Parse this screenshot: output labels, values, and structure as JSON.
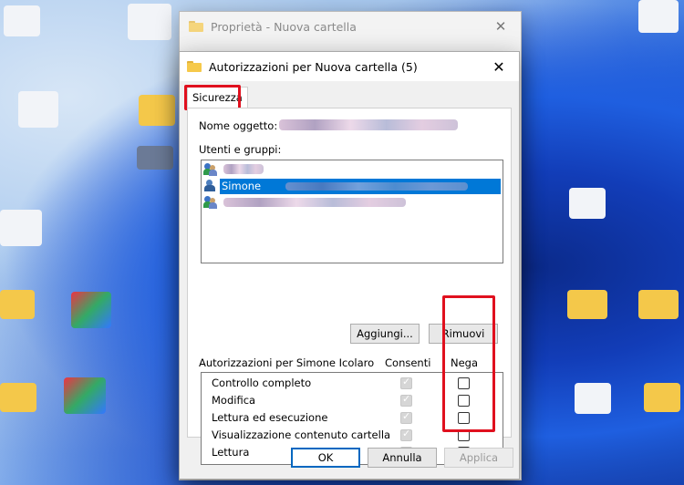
{
  "background_window": {
    "title": "Proprietà - Nuova cartella"
  },
  "dialog": {
    "title": "Autorizzazioni per Nuova cartella (5)",
    "tab_label": "Sicurezza",
    "object_name_label": "Nome oggetto:",
    "users_groups_label": "Utenti e gruppi:",
    "users": [
      {
        "name": "",
        "icon": "group-icon"
      },
      {
        "name": "Simone",
        "icon": "user-icon",
        "selected": true
      },
      {
        "name": "",
        "icon": "group-icon"
      }
    ],
    "add_button": "Aggiungi...",
    "remove_button": "Rimuovi",
    "permissions_for_label": "Autorizzazioni per Simone Icolaro",
    "allow_header": "Consenti",
    "deny_header": "Nega",
    "permissions": [
      {
        "name": "Controllo completo",
        "allow": true,
        "deny": false
      },
      {
        "name": "Modifica",
        "allow": true,
        "deny": false
      },
      {
        "name": "Lettura ed esecuzione",
        "allow": true,
        "deny": false
      },
      {
        "name": "Visualizzazione contenuto cartella",
        "allow": true,
        "deny": false
      },
      {
        "name": "Lettura",
        "allow": true,
        "deny": false
      }
    ],
    "ok_button": "OK",
    "cancel_button": "Annulla",
    "apply_button": "Applica"
  },
  "colors": {
    "highlight_red": "#e0101e",
    "selection_blue": "#0078d7"
  }
}
